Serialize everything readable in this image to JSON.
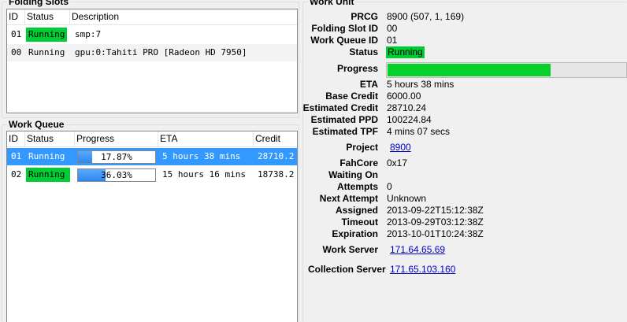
{
  "folding_slots": {
    "title": "Folding Slots",
    "columns": [
      "ID",
      "Status",
      "Description"
    ],
    "rows": [
      {
        "id": "01",
        "status": "Running",
        "description": "smp:7"
      },
      {
        "id": "00",
        "status": "Running",
        "description": "gpu:0:Tahiti PRO [Radeon HD 7950]"
      }
    ]
  },
  "work_queue": {
    "title": "Work Queue",
    "columns": [
      "ID",
      "Status",
      "Progress",
      "ETA",
      "Credit"
    ],
    "rows": [
      {
        "id": "01",
        "status": "Running",
        "progress_text": "17.87%",
        "progress": 17.87,
        "eta": "5 hours 38 mins",
        "credit": "28710.2"
      },
      {
        "id": "02",
        "status": "Running",
        "progress_text": "36.03%",
        "progress": 36.03,
        "eta": "15 hours 16 mins",
        "credit": "18738.2"
      }
    ]
  },
  "work_unit": {
    "title": "Work Unit",
    "prcg_label": "PRCG",
    "prcg": "8900 (507, 1, 169)",
    "slot_label": "Folding Slot ID",
    "slot": "00",
    "queue_label": "Work Queue ID",
    "queue": "01",
    "status_label": "Status",
    "status": "Running",
    "progress_label": "Progress",
    "progress": 0.68,
    "eta_label": "ETA",
    "eta": "5 hours 38 mins",
    "base_credit_label": "Base Credit",
    "base_credit": "6000.00",
    "est_credit_label": "Estimated Credit",
    "est_credit": "28710.24",
    "est_ppd_label": "Estimated PPD",
    "est_ppd": "100224.84",
    "est_tpf_label": "Estimated TPF",
    "est_tpf": "4 mins 07 secs",
    "project_label": "Project",
    "project": "8900",
    "fahcore_label": "FahCore",
    "fahcore": "0x17",
    "waiting_label": "Waiting On",
    "waiting": "",
    "attempts_label": "Attempts",
    "attempts": "0",
    "next_attempt_label": "Next Attempt",
    "next_attempt": "Unknown",
    "assigned_label": "Assigned",
    "assigned": "2013-09-22T15:12:38Z",
    "timeout_label": "Timeout",
    "timeout": "2013-09-29T03:12:38Z",
    "expiration_label": "Expiration",
    "expiration": "2013-10-01T10:24:38Z",
    "work_server_label": "Work Server",
    "work_server": "171.64.65.69",
    "collection_server_label": "Collection Server",
    "collection_server": "171.65.103.160"
  },
  "colors": {
    "running_green": "#00cc33",
    "selection": "#3399ff",
    "progress_green": "#06d12b"
  }
}
